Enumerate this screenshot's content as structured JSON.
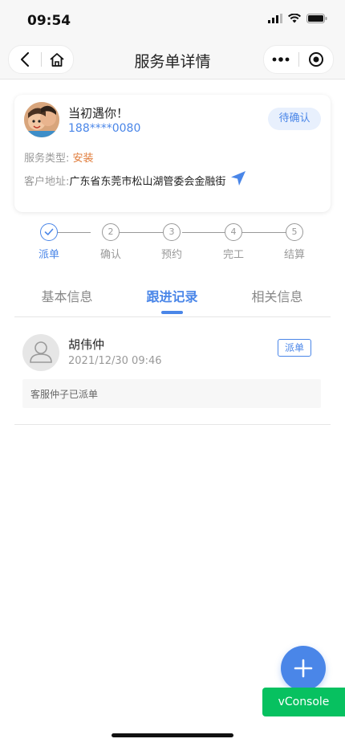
{
  "status_bar": {
    "time": "09:54"
  },
  "nav": {
    "title": "服务单详情"
  },
  "order": {
    "customer_name": "当初遇你！",
    "phone": "188****0080",
    "status": "待确认",
    "service_type_label": "服务类型:",
    "service_type": "安装",
    "address_label": "客户地址:",
    "address": "广东省东莞市松山湖管委会金融街"
  },
  "steps": [
    {
      "num": "✓",
      "label": "派单"
    },
    {
      "num": "2",
      "label": "确认"
    },
    {
      "num": "3",
      "label": "预约"
    },
    {
      "num": "4",
      "label": "完工"
    },
    {
      "num": "5",
      "label": "结算"
    }
  ],
  "tabs": [
    {
      "label": "基本信息"
    },
    {
      "label": "跟进记录"
    },
    {
      "label": "相关信息"
    }
  ],
  "records": [
    {
      "name": "胡伟仲",
      "time": "2021/12/30 09:46",
      "tag": "派单",
      "content": "客服仲子已派单"
    }
  ],
  "fab": {
    "label": "+"
  },
  "vconsole": {
    "label": "vConsole"
  },
  "colors": {
    "accent": "#4a86e8",
    "orange": "#e07b39",
    "vconsole_green": "#07c160"
  }
}
